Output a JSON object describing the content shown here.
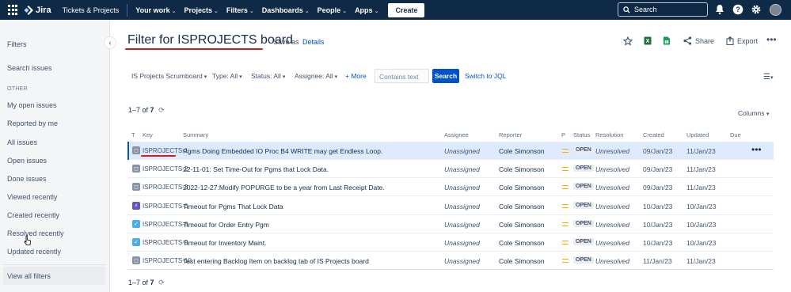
{
  "nav": {
    "logo": "Jira",
    "product_switch": "Tickets & Projects",
    "items": [
      {
        "label": "Your work",
        "chev": "⌄"
      },
      {
        "label": "Projects",
        "chev": "⌄"
      },
      {
        "label": "Filters",
        "chev": "⌄"
      },
      {
        "label": "Dashboards",
        "chev": "⌄"
      },
      {
        "label": "People",
        "chev": "⌄"
      },
      {
        "label": "Apps",
        "chev": "⌄"
      }
    ],
    "create": "Create",
    "search_placeholder": "Search"
  },
  "sidebar": {
    "title": "Filters",
    "search_issues": "Search issues",
    "section_other": "OTHER",
    "items": [
      "My open issues",
      "Reported by me",
      "All issues",
      "Open issues",
      "Done issues",
      "Viewed recently",
      "Created recently",
      "Resolved recently",
      "Updated recently"
    ],
    "view_all": "View all filters"
  },
  "header": {
    "title": "Filter for ISPROJECTS board",
    "save_as": "Save as",
    "details": "Details",
    "share": "Share",
    "export": "Export"
  },
  "filters": {
    "project": "IS Projects Scrumboard",
    "type": "Type: All",
    "status": "Status: All",
    "assignee": "Assignee: All",
    "more": "More",
    "contains_placeholder": "Contains text",
    "search": "Search",
    "switch_jql": "Switch to JQL"
  },
  "results": {
    "count_prefix": "1–7 of",
    "total": "7",
    "columns_label": "Columns"
  },
  "table": {
    "headers": {
      "t": "T",
      "key": "Key",
      "summary": "Summary",
      "assignee": "Assignee",
      "reporter": "Reporter",
      "p": "P",
      "status": "Status",
      "resolution": "Resolution",
      "created": "Created",
      "updated": "Updated",
      "due": "Due"
    },
    "rows": [
      {
        "type": "subtask",
        "key": "ISPROJECTS-1",
        "summary": "Pgms Doing Embedded IO Proc B4 WRITE may get Endless Loop.",
        "assignee": "Unassigned",
        "reporter": "Cole Simonson",
        "status": "OPEN",
        "resolution": "Unresolved",
        "created": "09/Jan/23",
        "updated": "11/Jan/23",
        "due": ""
      },
      {
        "type": "subtask",
        "key": "ISPROJECTS-2",
        "summary": "22-11-01: Set Time-Out for Pgms that Lock Data.",
        "assignee": "Unassigned",
        "reporter": "Cole Simonson",
        "status": "OPEN",
        "resolution": "Unresolved",
        "created": "09/Jan/23",
        "updated": "11/Jan/23",
        "due": ""
      },
      {
        "type": "subtask",
        "key": "ISPROJECTS-3",
        "summary": "2022-12-27:Modify POPURGE to be a year from Last Receipt Date.",
        "assignee": "Unassigned",
        "reporter": "Cole Simonson",
        "status": "OPEN",
        "resolution": "Unresolved",
        "created": "09/Jan/23",
        "updated": "11/Jan/23",
        "due": ""
      },
      {
        "type": "epic",
        "key": "ISPROJECTS-6",
        "summary": "Timeout for Pgms That Lock Data",
        "assignee": "Unassigned",
        "reporter": "Cole Simonson",
        "status": "OPEN",
        "resolution": "Unresolved",
        "created": "10/Jan/23",
        "updated": "10/Jan/23",
        "due": ""
      },
      {
        "type": "task",
        "key": "ISPROJECTS-8",
        "summary": "Timeout for Order Entry Pgm",
        "assignee": "Unassigned",
        "reporter": "Cole Simonson",
        "status": "OPEN",
        "resolution": "Unresolved",
        "created": "10/Jan/23",
        "updated": "10/Jan/23",
        "due": ""
      },
      {
        "type": "task",
        "key": "ISPROJECTS-9",
        "summary": "Timeout for Inventory Maint.",
        "assignee": "Unassigned",
        "reporter": "Cole Simonson",
        "status": "OPEN",
        "resolution": "Unresolved",
        "created": "10/Jan/23",
        "updated": "10/Jan/23",
        "due": ""
      },
      {
        "type": "subtask",
        "key": "ISPROJECTS-10",
        "summary": "Test entering Backlog Item on backlog tab of IS Projects board",
        "assignee": "Unassigned",
        "reporter": "Cole Simonson",
        "status": "OPEN",
        "resolution": "Unresolved",
        "created": "11/Jan/23",
        "updated": "11/Jan/23",
        "due": ""
      }
    ]
  },
  "colors": {
    "nav_bg": "#0e2a47",
    "accent": "#0052cc",
    "annotation": "#d01d1d",
    "priority": "#ffab00",
    "epic": "#6554c0",
    "task": "#4bade8",
    "subtask": "#8993a4"
  }
}
